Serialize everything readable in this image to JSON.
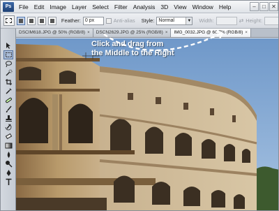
{
  "app": {
    "logo_text": "Ps"
  },
  "menu": [
    "File",
    "Edit",
    "Image",
    "Layer",
    "Select",
    "Filter",
    "Analysis",
    "3D",
    "View",
    "Window",
    "Help"
  ],
  "window_controls": {
    "minimize": "–",
    "restore": "□",
    "close": "✕"
  },
  "options": {
    "feather_label": "Feather:",
    "feather_value": "0 px",
    "antialias_label": "Anti-alias",
    "style_label": "Style:",
    "style_value": "Normal",
    "width_label": "Width:",
    "height_label": "Height:"
  },
  "tabs": [
    {
      "label": "DSCIM618.JPG @ 50% (RGB/8)",
      "close": "×"
    },
    {
      "label": "DSCN2629.JPG @ 25% (RGB/8)",
      "close": "×"
    },
    {
      "label": "IMG_0032.JPG @ 66.7% (RGB/8)",
      "close": "×"
    }
  ],
  "tools": [
    "move-icon",
    "marquee-icon",
    "lasso-icon",
    "quick-select-icon",
    "crop-icon",
    "eyedropper-icon",
    "healing-icon",
    "brush-icon",
    "clone-stamp-icon",
    "history-brush-icon",
    "eraser-icon",
    "gradient-icon",
    "blur-icon",
    "dodge-icon",
    "pen-icon",
    "type-icon"
  ],
  "canvas": {
    "instruction_line1": "Click and drag from",
    "instruction_line2": "the Middle to the Right"
  },
  "colors": {
    "sky": "#7fa5cf",
    "stone": "#b79b6e",
    "shadow": "#3b2f22",
    "accent": "#5277ad"
  }
}
